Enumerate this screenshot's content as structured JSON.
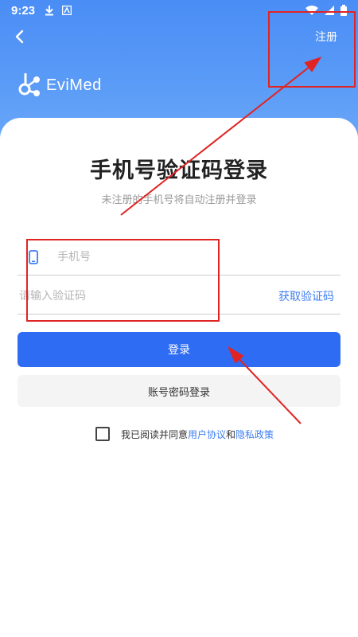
{
  "status_bar": {
    "time": "9:23",
    "icons": [
      "download-icon",
      "text-icon",
      "wifi-icon",
      "signal-icon",
      "battery-icon"
    ]
  },
  "header": {
    "register_label": "注册",
    "logo_text": "EviMed"
  },
  "main": {
    "title": "手机号验证码登录",
    "subtitle": "未注册的手机号将自动注册并登录",
    "phone_placeholder": "手机号",
    "code_placeholder": "请输入验证码",
    "get_code_label": "获取验证码",
    "login_button": "登录",
    "password_login_button": "账号密码登录"
  },
  "agreement": {
    "prefix": "我已阅读并同意",
    "user_agreement": "用户协议",
    "and": "和",
    "privacy_policy": "隐私政策",
    "checked": false
  },
  "colors": {
    "header_blue": "#4a8df5",
    "primary_button": "#2f6cf4",
    "link_blue": "#3d7ef2",
    "annotation_red": "#e02424"
  }
}
